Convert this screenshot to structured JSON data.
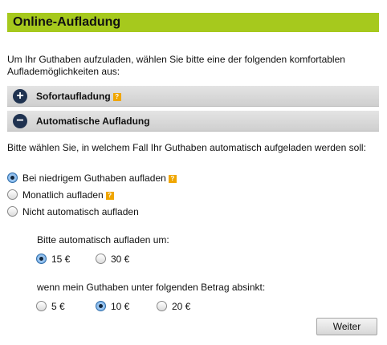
{
  "title": "Online-Aufladung",
  "intro": "Um Ihr Guthaben aufzuladen, wählen Sie bitte eine der folgenden komfortablen Auflademöglichkeiten aus:",
  "sections": [
    {
      "label": "Sofortaufladung",
      "icon": "plus-icon",
      "expanded": false
    },
    {
      "label": "Automatische Aufladung",
      "icon": "minus-icon",
      "expanded": true
    }
  ],
  "question": "Bitte wählen Sie, in welchem Fall Ihr Guthaben automatisch aufgeladen werden soll:",
  "modes": [
    {
      "label": "Bei niedrigem Guthaben aufladen",
      "selected": true,
      "help": true
    },
    {
      "label": "Monatlich aufladen",
      "selected": false,
      "help": true
    },
    {
      "label": "Nicht automatisch aufladen",
      "selected": false,
      "help": false
    }
  ],
  "amount": {
    "label": "Bitte automatisch aufladen um:",
    "options": [
      {
        "label": "15 €",
        "selected": true
      },
      {
        "label": "30 €",
        "selected": false
      }
    ]
  },
  "threshold": {
    "label": "wenn mein Guthaben unter folgenden Betrag absinkt:",
    "options": [
      {
        "label": "5 €",
        "selected": false
      },
      {
        "label": "10 €",
        "selected": true
      },
      {
        "label": "20 €",
        "selected": false
      }
    ]
  },
  "help_glyph": "?",
  "submit_label": "Weiter",
  "colors": {
    "title_bar": "#a6c91d",
    "section_icon": "#1f3250",
    "help_icon": "#f0a600"
  }
}
